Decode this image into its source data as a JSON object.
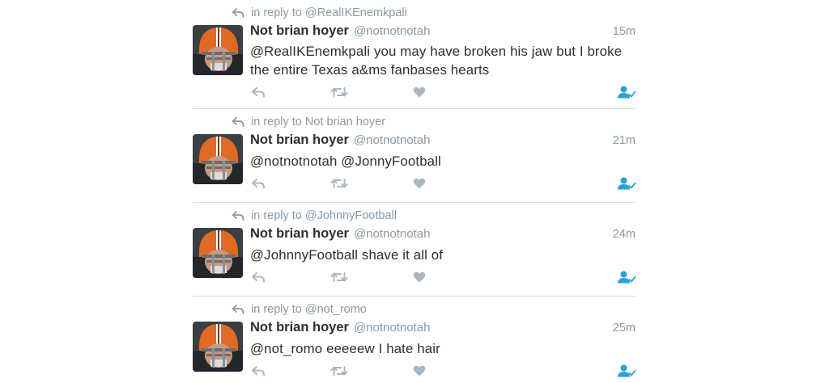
{
  "colors": {
    "text": "#292f33",
    "muted": "#8899a6",
    "icon": "#aab8c2",
    "accent": "#2b9fdc",
    "divider": "#d9dde0"
  },
  "icons": {
    "reply_context": "reply-arrow-icon",
    "reply": "reply-icon",
    "retweet": "retweet-icon",
    "like": "heart-icon",
    "follow": "following-person-icon"
  },
  "tweets": [
    {
      "reply_context": "in reply to @RealIKEnemkpali",
      "display_name": "Not brian hoyer",
      "handle": "@notnotnotah",
      "time": "15m",
      "text_lines": [
        "@RealIKEnemkpali you may have broken his jaw but I broke",
        "the entire Texas a&ms fanbases hearts"
      ]
    },
    {
      "reply_context": "in reply to Not brian hoyer",
      "display_name": "Not brian hoyer",
      "handle": "@notnotnotah",
      "time": "21m",
      "text_lines": [
        "@notnotnotah @JonnyFootball"
      ]
    },
    {
      "reply_context": "in reply to @JohnnyFootball",
      "display_name": "Not brian hoyer",
      "handle": "@notnotnotah",
      "time": "24m",
      "text_lines": [
        "@JohnnyFootball shave it all of"
      ]
    },
    {
      "reply_context": "in reply to @not_romo",
      "display_name": "Not brian hoyer",
      "handle": "@notnotnotah",
      "time": "25m",
      "text_lines": [
        "@not_romo eeeeew I hate hair"
      ]
    }
  ]
}
